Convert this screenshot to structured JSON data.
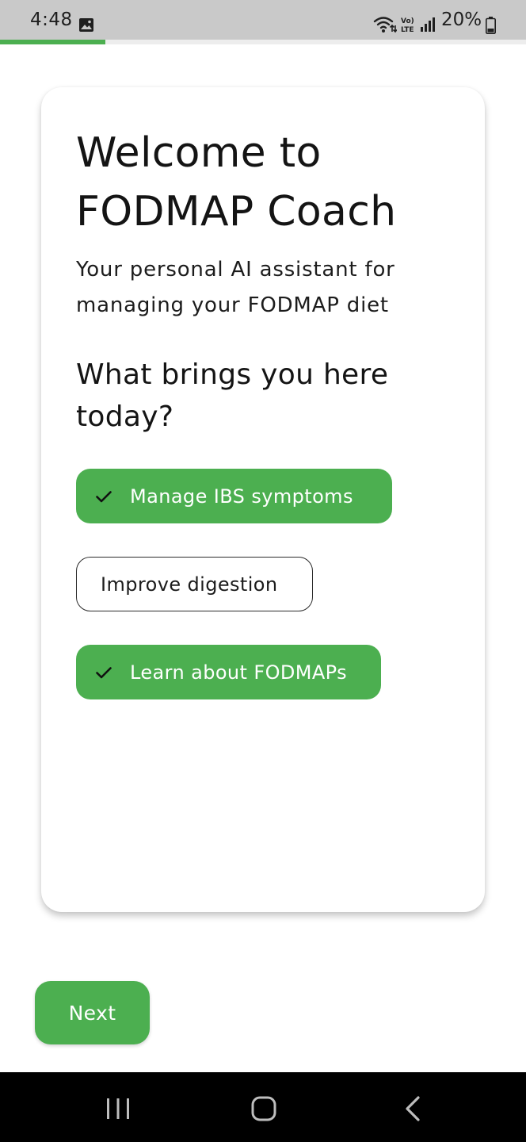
{
  "status_bar": {
    "time": "4:48",
    "battery": "20%",
    "icons": [
      "gallery-icon",
      "wifi-icon",
      "volte-icon",
      "signal-icon",
      "battery-icon"
    ]
  },
  "progress": {
    "fraction": 0.2
  },
  "card": {
    "title": "Welcome to FODMAP Coach",
    "subtitle": "Your personal AI assistant for managing your FODMAP diet",
    "question": "What brings you here today?",
    "options": [
      {
        "label": "Manage IBS symptoms",
        "selected": true
      },
      {
        "label": "Improve digestion",
        "selected": false
      },
      {
        "label": "Learn about FODMAPs",
        "selected": true
      }
    ]
  },
  "next_button": {
    "label": "Next"
  },
  "nav_bar": {
    "icons": [
      "recents-icon",
      "home-icon",
      "back-icon"
    ]
  },
  "colors": {
    "accent": "#4caf50",
    "status_bar": "#c9c9c9",
    "nav_bar": "#000000"
  }
}
